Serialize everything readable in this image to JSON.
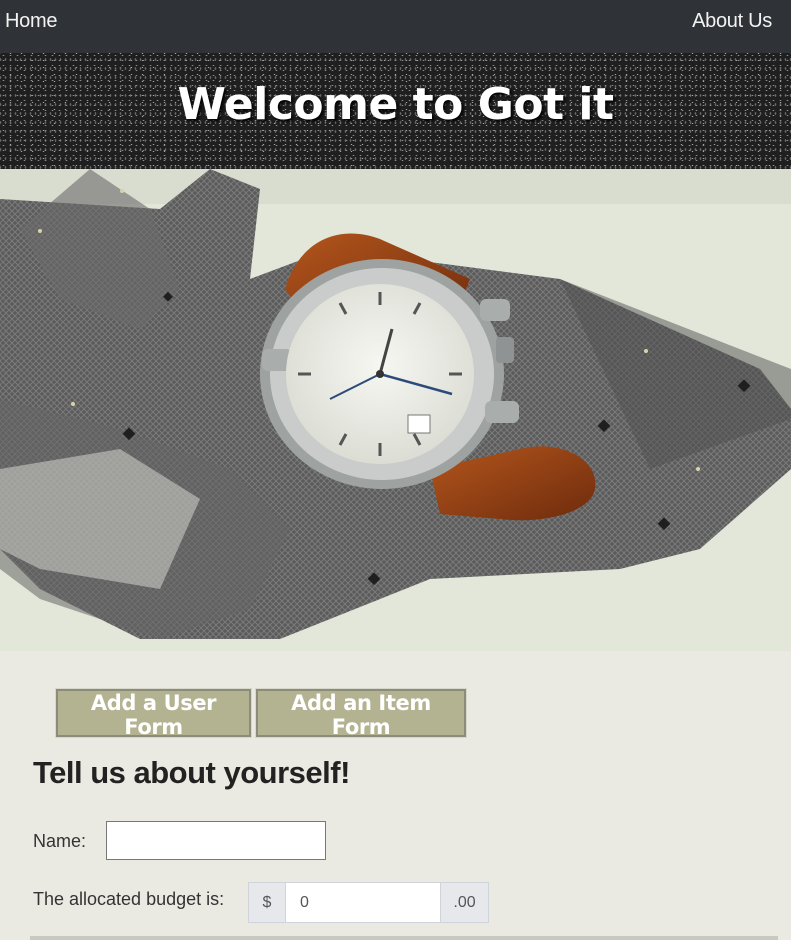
{
  "nav": {
    "home_label": "Home",
    "about_label": "About Us"
  },
  "banner": {
    "title": "Welcome to Got it"
  },
  "hero": {
    "image": "wristwatch-on-tie-photo"
  },
  "tabs": [
    {
      "label": "Add a User Form"
    },
    {
      "label": "Add an Item Form"
    }
  ],
  "form": {
    "heading": "Tell us about yourself!",
    "name_label": "Name:",
    "name_value": "",
    "budget_label": "The allocated budget is:",
    "currency_prefix": "$",
    "budget_value": "0",
    "budget_suffix": ".00"
  },
  "colors": {
    "navbar": "#2f3337",
    "tab_button": "#b3b391",
    "page_background": "#ebeae2"
  }
}
